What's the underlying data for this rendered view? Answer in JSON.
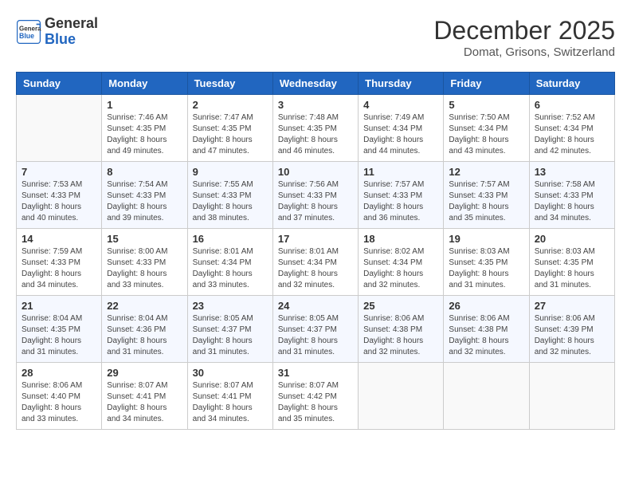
{
  "logo": {
    "general": "General",
    "blue": "Blue"
  },
  "header": {
    "month": "December 2025",
    "location": "Domat, Grisons, Switzerland"
  },
  "days_of_week": [
    "Sunday",
    "Monday",
    "Tuesday",
    "Wednesday",
    "Thursday",
    "Friday",
    "Saturday"
  ],
  "weeks": [
    [
      {
        "day": "",
        "info": ""
      },
      {
        "day": "1",
        "info": "Sunrise: 7:46 AM\nSunset: 4:35 PM\nDaylight: 8 hours\nand 49 minutes."
      },
      {
        "day": "2",
        "info": "Sunrise: 7:47 AM\nSunset: 4:35 PM\nDaylight: 8 hours\nand 47 minutes."
      },
      {
        "day": "3",
        "info": "Sunrise: 7:48 AM\nSunset: 4:35 PM\nDaylight: 8 hours\nand 46 minutes."
      },
      {
        "day": "4",
        "info": "Sunrise: 7:49 AM\nSunset: 4:34 PM\nDaylight: 8 hours\nand 44 minutes."
      },
      {
        "day": "5",
        "info": "Sunrise: 7:50 AM\nSunset: 4:34 PM\nDaylight: 8 hours\nand 43 minutes."
      },
      {
        "day": "6",
        "info": "Sunrise: 7:52 AM\nSunset: 4:34 PM\nDaylight: 8 hours\nand 42 minutes."
      }
    ],
    [
      {
        "day": "7",
        "info": "Sunrise: 7:53 AM\nSunset: 4:33 PM\nDaylight: 8 hours\nand 40 minutes."
      },
      {
        "day": "8",
        "info": "Sunrise: 7:54 AM\nSunset: 4:33 PM\nDaylight: 8 hours\nand 39 minutes."
      },
      {
        "day": "9",
        "info": "Sunrise: 7:55 AM\nSunset: 4:33 PM\nDaylight: 8 hours\nand 38 minutes."
      },
      {
        "day": "10",
        "info": "Sunrise: 7:56 AM\nSunset: 4:33 PM\nDaylight: 8 hours\nand 37 minutes."
      },
      {
        "day": "11",
        "info": "Sunrise: 7:57 AM\nSunset: 4:33 PM\nDaylight: 8 hours\nand 36 minutes."
      },
      {
        "day": "12",
        "info": "Sunrise: 7:57 AM\nSunset: 4:33 PM\nDaylight: 8 hours\nand 35 minutes."
      },
      {
        "day": "13",
        "info": "Sunrise: 7:58 AM\nSunset: 4:33 PM\nDaylight: 8 hours\nand 34 minutes."
      }
    ],
    [
      {
        "day": "14",
        "info": "Sunrise: 7:59 AM\nSunset: 4:33 PM\nDaylight: 8 hours\nand 34 minutes."
      },
      {
        "day": "15",
        "info": "Sunrise: 8:00 AM\nSunset: 4:33 PM\nDaylight: 8 hours\nand 33 minutes."
      },
      {
        "day": "16",
        "info": "Sunrise: 8:01 AM\nSunset: 4:34 PM\nDaylight: 8 hours\nand 33 minutes."
      },
      {
        "day": "17",
        "info": "Sunrise: 8:01 AM\nSunset: 4:34 PM\nDaylight: 8 hours\nand 32 minutes."
      },
      {
        "day": "18",
        "info": "Sunrise: 8:02 AM\nSunset: 4:34 PM\nDaylight: 8 hours\nand 32 minutes."
      },
      {
        "day": "19",
        "info": "Sunrise: 8:03 AM\nSunset: 4:35 PM\nDaylight: 8 hours\nand 31 minutes."
      },
      {
        "day": "20",
        "info": "Sunrise: 8:03 AM\nSunset: 4:35 PM\nDaylight: 8 hours\nand 31 minutes."
      }
    ],
    [
      {
        "day": "21",
        "info": "Sunrise: 8:04 AM\nSunset: 4:35 PM\nDaylight: 8 hours\nand 31 minutes."
      },
      {
        "day": "22",
        "info": "Sunrise: 8:04 AM\nSunset: 4:36 PM\nDaylight: 8 hours\nand 31 minutes."
      },
      {
        "day": "23",
        "info": "Sunrise: 8:05 AM\nSunset: 4:37 PM\nDaylight: 8 hours\nand 31 minutes."
      },
      {
        "day": "24",
        "info": "Sunrise: 8:05 AM\nSunset: 4:37 PM\nDaylight: 8 hours\nand 31 minutes."
      },
      {
        "day": "25",
        "info": "Sunrise: 8:06 AM\nSunset: 4:38 PM\nDaylight: 8 hours\nand 32 minutes."
      },
      {
        "day": "26",
        "info": "Sunrise: 8:06 AM\nSunset: 4:38 PM\nDaylight: 8 hours\nand 32 minutes."
      },
      {
        "day": "27",
        "info": "Sunrise: 8:06 AM\nSunset: 4:39 PM\nDaylight: 8 hours\nand 32 minutes."
      }
    ],
    [
      {
        "day": "28",
        "info": "Sunrise: 8:06 AM\nSunset: 4:40 PM\nDaylight: 8 hours\nand 33 minutes."
      },
      {
        "day": "29",
        "info": "Sunrise: 8:07 AM\nSunset: 4:41 PM\nDaylight: 8 hours\nand 34 minutes."
      },
      {
        "day": "30",
        "info": "Sunrise: 8:07 AM\nSunset: 4:41 PM\nDaylight: 8 hours\nand 34 minutes."
      },
      {
        "day": "31",
        "info": "Sunrise: 8:07 AM\nSunset: 4:42 PM\nDaylight: 8 hours\nand 35 minutes."
      },
      {
        "day": "",
        "info": ""
      },
      {
        "day": "",
        "info": ""
      },
      {
        "day": "",
        "info": ""
      }
    ]
  ]
}
